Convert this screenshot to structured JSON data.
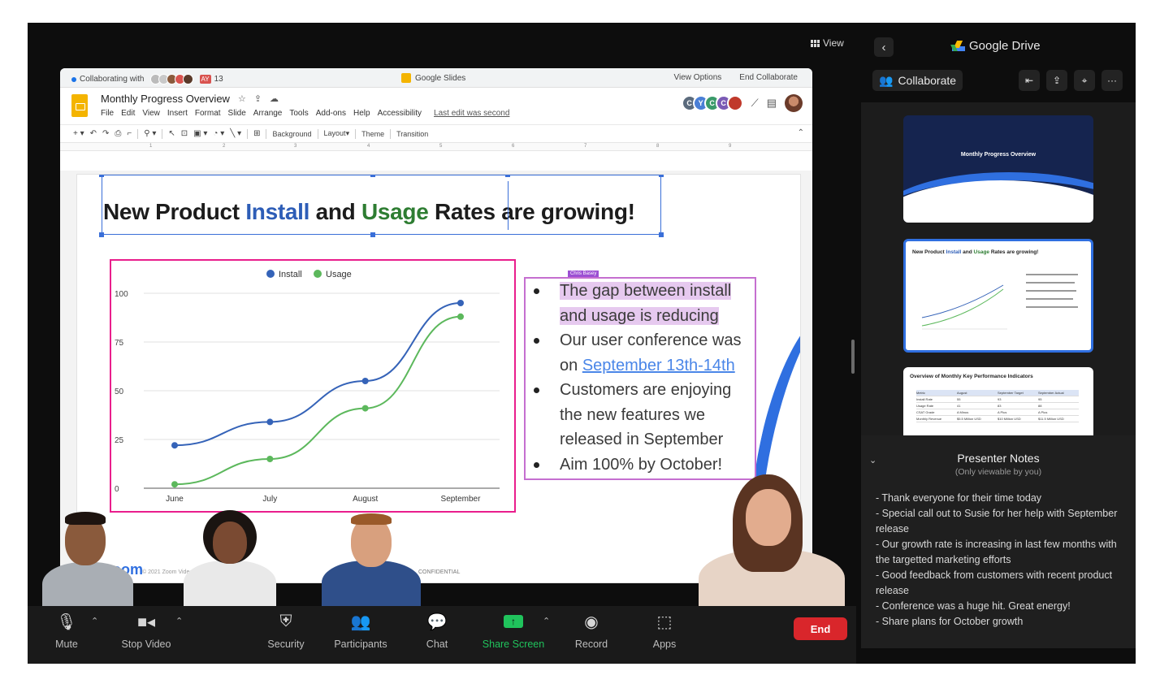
{
  "zoom": {
    "view_label": "View",
    "controls": {
      "mute": "Mute",
      "stop_video": "Stop Video",
      "security": "Security",
      "participants": "Participants",
      "chat": "Chat",
      "share_screen": "Share Screen",
      "record": "Record",
      "apps": "Apps",
      "end": "End"
    }
  },
  "slides_window": {
    "collaborating_with": "Collaborating with",
    "collaborator_initials": "AY",
    "collaborator_count": "13",
    "app_title": "Google Slides",
    "view_options": "View Options",
    "end_collaborate": "End Collaborate",
    "doc_title": "Monthly Progress Overview",
    "menu": [
      "File",
      "Edit",
      "View",
      "Insert",
      "Format",
      "Slide",
      "Arrange",
      "Tools",
      "Add-ons",
      "Help",
      "Accessibility"
    ],
    "last_edit": "Last edit was second",
    "collab_avatars": [
      "C",
      "Y",
      "C",
      "C"
    ],
    "toolbar": {
      "background": "Background",
      "layout": "Layout",
      "theme": "Theme",
      "transition": "Transition"
    },
    "ruler_marks": [
      "1",
      "2",
      "3",
      "4",
      "5",
      "6",
      "7",
      "8",
      "9"
    ]
  },
  "slide": {
    "title_part1": "New Product ",
    "title_install": "Install",
    "title_and": " and ",
    "title_usage": "Usage",
    "title_part2": " Rates are growing!",
    "collaborator_tag": "Chris Basey",
    "bullets": [
      {
        "text": "The gap between install and usage is reducing",
        "highlight": true
      },
      {
        "text_prefix": "Our user conference was on ",
        "link": "September 13th-14th"
      },
      {
        "text": "Customers are enjoying the new features we released in September"
      },
      {
        "text": "Aim 100% by October!"
      }
    ],
    "footer_logo": "zoom",
    "footer_copyright": "© 2021 Zoom Video",
    "footer_confidential": "CONFIDENTIAL"
  },
  "chart_data": {
    "type": "line",
    "categories": [
      "June",
      "July",
      "August",
      "September"
    ],
    "series": [
      {
        "name": "Install",
        "values": [
          22,
          34,
          55,
          95
        ],
        "color": "#3563b8"
      },
      {
        "name": "Usage",
        "values": [
          2,
          15,
          41,
          88
        ],
        "color": "#5cb85c"
      }
    ],
    "yticks": [
      "0",
      "25",
      "50",
      "75",
      "100"
    ],
    "ylim": [
      0,
      100
    ],
    "grid": true,
    "legend_placement": "top"
  },
  "right_panel": {
    "title": "Google Drive",
    "collaborate_label": "Collaborate",
    "thumbnails": [
      {
        "title": "Monthly Progress Overview"
      },
      {
        "title_a": "New Product ",
        "title_install": "Install",
        "title_b": " and ",
        "title_usage": "Usage",
        "title_c": " Rates are growing!"
      },
      {
        "title": "Overview of Monthly Key Performance Indicators"
      }
    ],
    "kpi_table": {
      "headers": [
        "Metric",
        "August",
        "September Target",
        "September Actual"
      ],
      "rows": [
        [
          "Install Rate",
          "55",
          "93",
          "95"
        ],
        [
          "Usage Rate",
          "41",
          "83",
          "88"
        ],
        [
          "CSAT Grade",
          "A Minus",
          "A Plus",
          "A Plus"
        ],
        [
          "Monthly Revenue",
          "$5.5 Million USD",
          "$10 Million USD",
          "$11.5 Million USD"
        ]
      ]
    },
    "notes_title": "Presenter Notes",
    "notes_subtitle": "(Only viewable by you)",
    "notes": [
      "- Thank everyone for their time today",
      "- Special call out to Susie for her help with September release",
      "- Our growth rate is increasing in last few months with the targetted marketing efforts",
      "- Good feedback from customers with recent product release",
      "- Conference was a huge hit. Great energy!",
      "- Share plans for October growth"
    ]
  }
}
